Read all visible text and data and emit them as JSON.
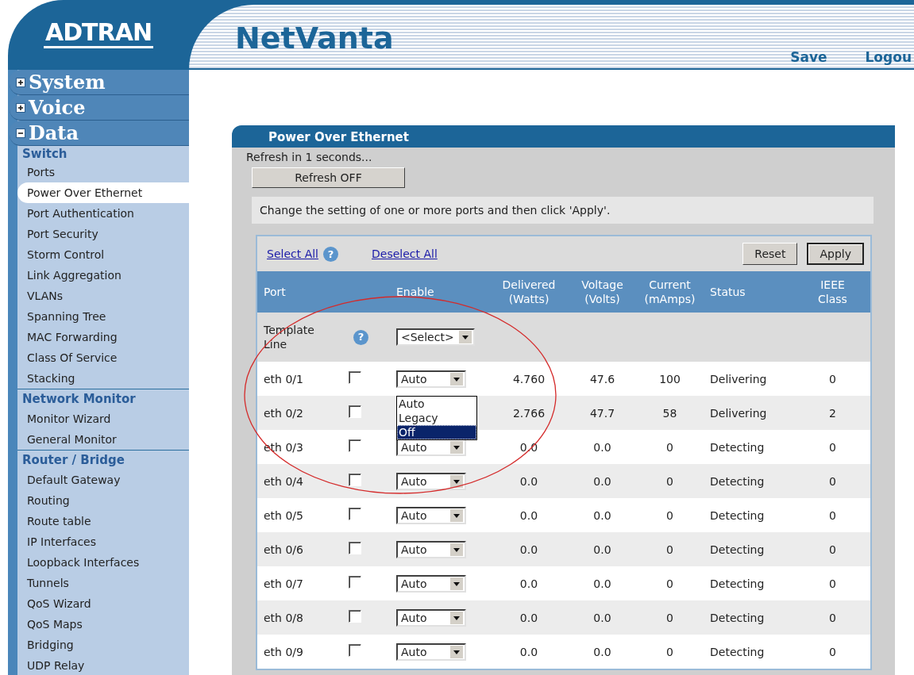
{
  "logo": {
    "text": "ADTRAN"
  },
  "header": {
    "title": "NetVanta",
    "links": [
      "Save",
      "Logou"
    ]
  },
  "sidebar": {
    "sections": [
      {
        "label": "System",
        "expanded": false
      },
      {
        "label": "Voice",
        "expanded": false
      },
      {
        "label": "Data",
        "expanded": true,
        "groups": [
          {
            "title": "Switch",
            "items": [
              {
                "label": "Ports",
                "selected": false
              },
              {
                "label": "Power Over Ethernet",
                "selected": true
              },
              {
                "label": "Port Authentication",
                "selected": false
              },
              {
                "label": "Port Security",
                "selected": false
              },
              {
                "label": "Storm Control",
                "selected": false
              },
              {
                "label": "Link Aggregation",
                "selected": false
              },
              {
                "label": "VLANs",
                "selected": false
              },
              {
                "label": "Spanning Tree",
                "selected": false
              },
              {
                "label": "MAC Forwarding",
                "selected": false
              },
              {
                "label": "Class Of Service",
                "selected": false
              },
              {
                "label": "Stacking",
                "selected": false
              }
            ]
          },
          {
            "title": "Network Monitor",
            "items": [
              {
                "label": "Monitor Wizard",
                "selected": false
              },
              {
                "label": "General Monitor",
                "selected": false
              }
            ]
          },
          {
            "title": "Router / Bridge",
            "items": [
              {
                "label": "Default Gateway",
                "selected": false
              },
              {
                "label": "Routing",
                "selected": false
              },
              {
                "label": "Route table",
                "selected": false
              },
              {
                "label": "IP Interfaces",
                "selected": false
              },
              {
                "label": "Loopback Interfaces",
                "selected": false
              },
              {
                "label": "Tunnels",
                "selected": false
              },
              {
                "label": "QoS Wizard",
                "selected": false
              },
              {
                "label": "QoS Maps",
                "selected": false
              },
              {
                "label": "Bridging",
                "selected": false
              },
              {
                "label": "UDP Relay",
                "selected": false
              }
            ]
          }
        ]
      }
    ]
  },
  "panel": {
    "title": "Power Over Ethernet",
    "refresh_text": "Refresh in 1 seconds...",
    "refresh_button": "Refresh OFF",
    "info": "Change the setting of one or more ports and then click 'Apply'.",
    "select_all": "Select All",
    "select_all_help": "?",
    "deselect_all": "Deselect All",
    "buttons": [
      "Reset",
      "Apply"
    ],
    "columns": [
      "Port",
      "Enable",
      "Delivered (Watts)",
      "Voltage (Volts)",
      "Current (mAmps)",
      "Status",
      "IEEE Class"
    ],
    "template": {
      "label": "Template Line",
      "help": "?",
      "select": "<Select>"
    },
    "rows": [
      {
        "port": "eth 0/1",
        "checked": false,
        "enable": "Auto",
        "options": [
          {
            "label": "Auto",
            "selected": false
          },
          {
            "label": "Legacy",
            "selected": false
          },
          {
            "label": "Off",
            "selected": true
          }
        ],
        "delivered": "4.760",
        "voltage": "47.6",
        "current": "100",
        "status": "Delivering",
        "ieee_class": "0"
      },
      {
        "port": "eth 0/2",
        "checked": false,
        "delivered": "2.766",
        "voltage": "47.7",
        "current": "58",
        "status": "Delivering",
        "ieee_class": "2"
      },
      {
        "port": "eth 0/3",
        "checked": false,
        "enable": "Auto",
        "delivered": "0.0",
        "voltage": "0.0",
        "current": "0",
        "status": "Detecting",
        "ieee_class": "0"
      },
      {
        "port": "eth 0/4",
        "checked": false,
        "enable": "Auto",
        "delivered": "0.0",
        "voltage": "0.0",
        "current": "0",
        "status": "Detecting",
        "ieee_class": "0"
      },
      {
        "port": "eth 0/5",
        "checked": false,
        "enable": "Auto",
        "delivered": "0.0",
        "voltage": "0.0",
        "current": "0",
        "status": "Detecting",
        "ieee_class": "0"
      },
      {
        "port": "eth 0/6",
        "checked": false,
        "enable": "Auto",
        "delivered": "0.0",
        "voltage": "0.0",
        "current": "0",
        "status": "Detecting",
        "ieee_class": "0"
      },
      {
        "port": "eth 0/7",
        "checked": false,
        "enable": "Auto",
        "delivered": "0.0",
        "voltage": "0.0",
        "current": "0",
        "status": "Detecting",
        "ieee_class": "0"
      },
      {
        "port": "eth 0/8",
        "checked": false,
        "enable": "Auto",
        "delivered": "0.0",
        "voltage": "0.0",
        "current": "0",
        "status": "Detecting",
        "ieee_class": "0"
      },
      {
        "port": "eth 0/9",
        "checked": false,
        "enable": "Auto",
        "delivered": "0.0",
        "voltage": "0.0",
        "current": "0",
        "status": "Detecting",
        "ieee_class": "0"
      }
    ]
  },
  "annotation": {
    "kind": "ellipse"
  }
}
